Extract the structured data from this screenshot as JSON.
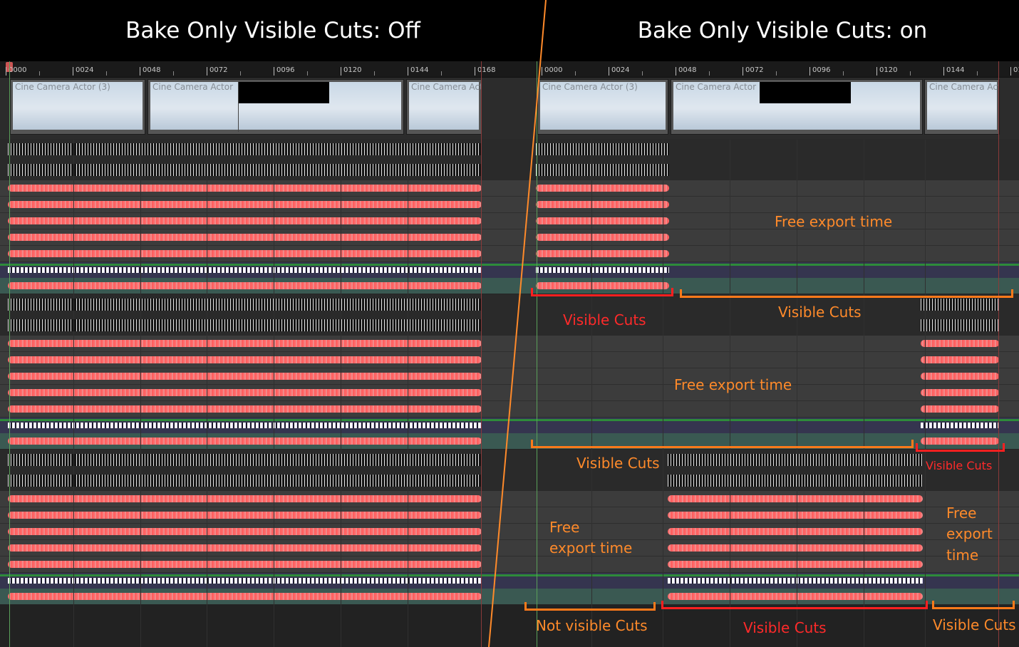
{
  "header": {
    "left_title": "Bake Only Visible Cuts: Off",
    "right_title": "Bake Only Visible Cuts: on"
  },
  "ruler": {
    "labels": [
      "0000",
      "0024",
      "0048",
      "0072",
      "0096",
      "0120",
      "0144",
      "0168"
    ]
  },
  "left_panel": {
    "cuts": [
      "Cine Camera Actor (3)",
      "Cine Camera Actor",
      "Cine Camera Act"
    ]
  },
  "right_panel": {
    "cuts": [
      "Cine Camera Actor (3)",
      "Cine Camera Actor",
      "Cine Camera Act"
    ]
  },
  "annotations": {
    "free_export_1": "Free export time",
    "visible_cuts_1_red": "Visible Cuts",
    "visible_cuts_1_orange": "Visible Cuts",
    "free_export_2": "Free export time",
    "visible_cuts_2_orange": "Visible Cuts",
    "visible_cuts_2_red": "Visible Cuts",
    "free_export_3a": "Free",
    "free_export_3b": "export time",
    "free_export_4a": "Free",
    "free_export_4b": "export",
    "free_export_4c": "time",
    "not_visible_cuts": "Not visible Cuts",
    "visible_cuts_3_red": "Visible Cuts",
    "visible_cuts_3_orange": "Visible Cuts"
  },
  "colors": {
    "annotation_orange": "#ff8a2a",
    "annotation_red": "#ff2a2a",
    "keyframe_red": "#ff6b6b",
    "playhead_green": "#5aa05a",
    "header_bg": "#000000"
  }
}
